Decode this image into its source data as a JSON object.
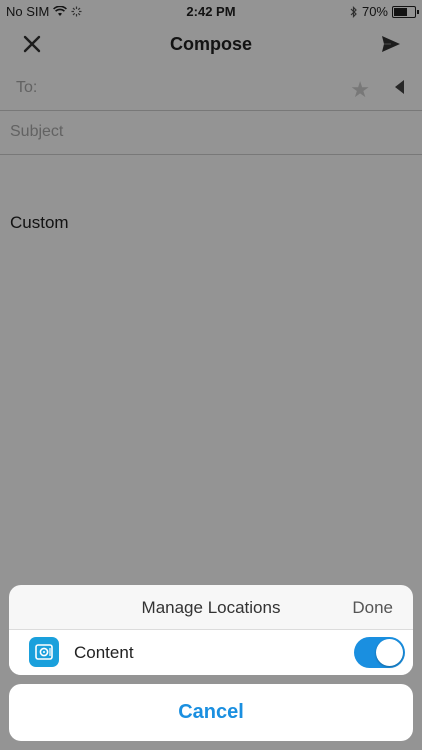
{
  "status_bar": {
    "carrier": "No SIM",
    "time": "2:42 PM",
    "battery": "70%",
    "battery_level": 0.7
  },
  "nav": {
    "title": "Compose"
  },
  "compose": {
    "to_label": "To:",
    "subject_placeholder": "Subject",
    "body": "Custom"
  },
  "sheet": {
    "title": "Manage Locations",
    "done_label": "Done",
    "locations": [
      {
        "label": "Content",
        "enabled": true,
        "icon": "storage-icon"
      }
    ],
    "accent_color": "#1a8fe0"
  },
  "cancel_label": "Cancel"
}
